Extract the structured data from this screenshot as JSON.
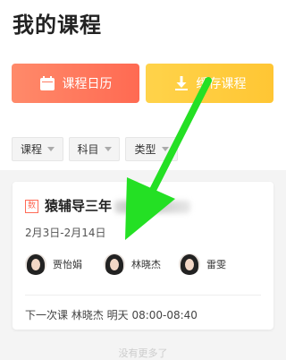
{
  "page": {
    "title": "我的课程"
  },
  "actions": {
    "calendar_label": "课程日历",
    "download_label": "缓存课程"
  },
  "filters": [
    {
      "label": "课程"
    },
    {
      "label": "科目"
    },
    {
      "label": "类型"
    }
  ],
  "course": {
    "tag": "数",
    "title": "猿辅导三年",
    "date_range": "2月3日-2月14日",
    "teachers": [
      {
        "name": "贾怡娟"
      },
      {
        "name": "林晓杰"
      },
      {
        "name": "雷雯"
      }
    ],
    "next_lesson": "下一次课 林晓杰 明天 08:00-08:40"
  },
  "footer": {
    "no_more": "没有更多了"
  },
  "colors": {
    "calendar_button": "#ff6a52",
    "download_button": "#ffc634",
    "overlay_arrow": "#22dd22"
  }
}
